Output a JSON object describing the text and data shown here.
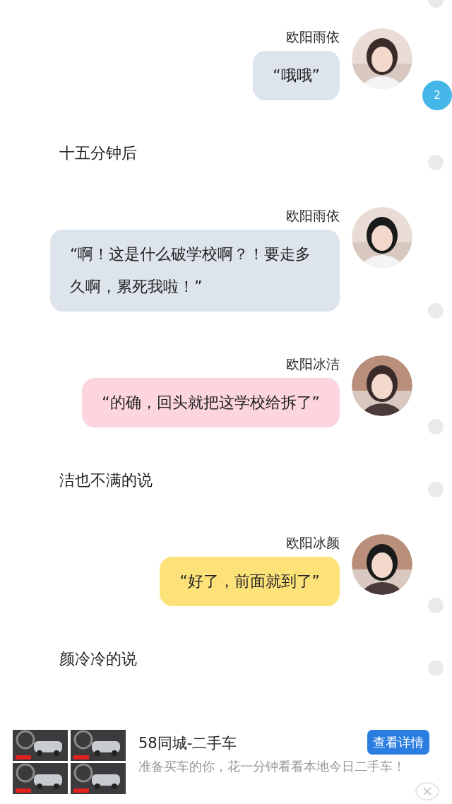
{
  "feed": [
    {
      "kind": "message",
      "sender": "欧阳雨依",
      "text": "“哦哦”",
      "color": "#dde4ec",
      "badge": "2"
    },
    {
      "kind": "narration",
      "text": "十五分钟后"
    },
    {
      "kind": "message",
      "sender": "欧阳雨依",
      "text": "“啊！这是什么破学校啊？！要走多久啊，累死我啦！”",
      "color": "#dde4ec"
    },
    {
      "kind": "message",
      "sender": "欧阳冰洁",
      "text": "“的确，回头就把这学校给拆了”",
      "color": "#fdd5de"
    },
    {
      "kind": "narration",
      "text": "洁也不满的说"
    },
    {
      "kind": "message",
      "sender": "欧阳冰颜",
      "text": "“好了，前面就到了”",
      "color": "#fde27a"
    },
    {
      "kind": "narration",
      "text": "颜冷冷的说"
    }
  ],
  "ad": {
    "title": "58同城-二手车",
    "button": "查看详情",
    "description": "准备买车的你，花一分钟看看本地今日二手车！"
  }
}
